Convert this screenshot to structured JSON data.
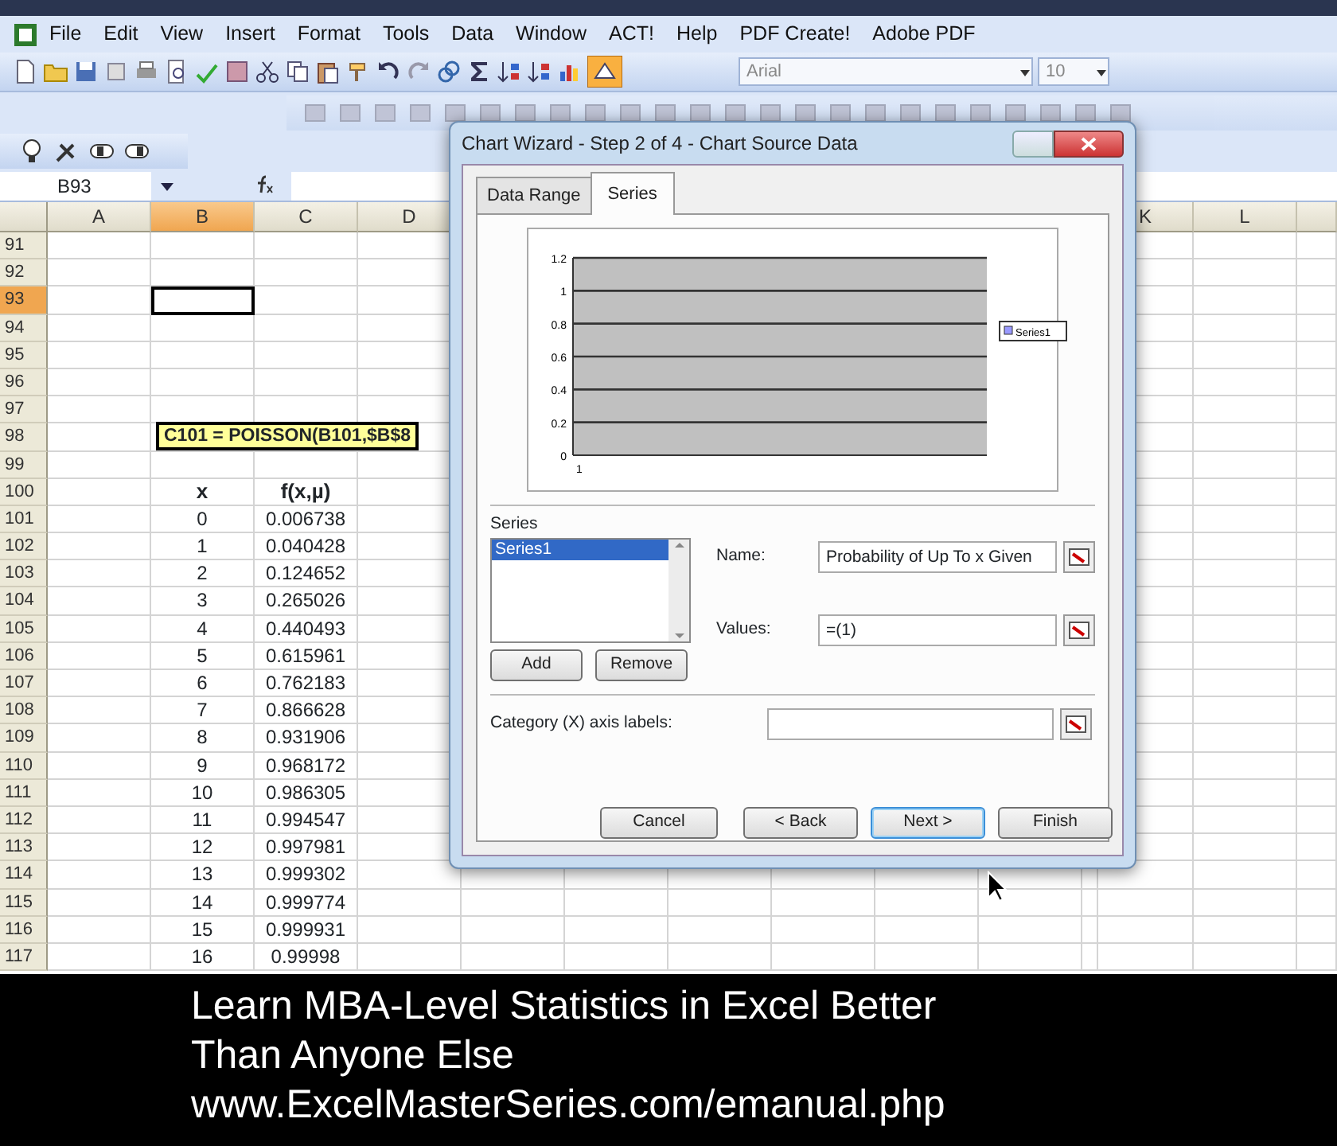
{
  "menu_bar": {
    "items": [
      "File",
      "Edit",
      "View",
      "Insert",
      "Format",
      "Tools",
      "Data",
      "Window",
      "ACT!",
      "Help",
      "PDF Create!",
      "Adobe PDF"
    ]
  },
  "formatting": {
    "font": "Arial",
    "font_size": "10"
  },
  "name_box": "B93",
  "sheet": {
    "columns": [
      {
        "label": "A",
        "selected": false
      },
      {
        "label": "B",
        "selected": true
      },
      {
        "label": "C",
        "selected": false
      },
      {
        "label": "D",
        "selected": false
      },
      {
        "label": "K",
        "selected": false
      },
      {
        "label": "L",
        "selected": false
      }
    ],
    "rows": [
      {
        "number": "91",
        "selected": false
      },
      {
        "number": "92",
        "selected": false
      },
      {
        "number": "93",
        "selected": true
      },
      {
        "number": "94",
        "selected": false
      },
      {
        "number": "95",
        "selected": false
      },
      {
        "number": "96",
        "selected": false
      },
      {
        "number": "97",
        "selected": false
      },
      {
        "number": "98",
        "selected": false,
        "note": "C101 = POISSON(B101,$B$8"
      },
      {
        "number": "99",
        "selected": false
      },
      {
        "number": "100",
        "selected": false,
        "kind": "header",
        "column_b": "x",
        "column_c": "f(x,µ)"
      },
      {
        "number": "101",
        "selected": false,
        "column_b": "0",
        "column_c": "0.006738"
      },
      {
        "number": "102",
        "selected": false,
        "column_b": "1",
        "column_c": "0.040428"
      },
      {
        "number": "103",
        "selected": false,
        "column_b": "2",
        "column_c": "0.124652"
      },
      {
        "number": "104",
        "selected": false,
        "column_b": "3",
        "column_c": "0.265026"
      },
      {
        "number": "105",
        "selected": false,
        "column_b": "4",
        "column_c": "0.440493"
      },
      {
        "number": "106",
        "selected": false,
        "column_b": "5",
        "column_c": "0.615961"
      },
      {
        "number": "107",
        "selected": false,
        "column_b": "6",
        "column_c": "0.762183"
      },
      {
        "number": "108",
        "selected": false,
        "column_b": "7",
        "column_c": "0.866628"
      },
      {
        "number": "109",
        "selected": false,
        "column_b": "8",
        "column_c": "0.931906"
      },
      {
        "number": "110",
        "selected": false,
        "column_b": "9",
        "column_c": "0.968172"
      },
      {
        "number": "111",
        "selected": false,
        "column_b": "10",
        "column_c": "0.986305"
      },
      {
        "number": "112",
        "selected": false,
        "column_b": "11",
        "column_c": "0.994547"
      },
      {
        "number": "113",
        "selected": false,
        "column_b": "12",
        "column_c": "0.997981"
      },
      {
        "number": "114",
        "selected": false,
        "column_b": "13",
        "column_c": "0.999302"
      },
      {
        "number": "115",
        "selected": false,
        "column_b": "14",
        "column_c": "0.999774"
      },
      {
        "number": "116",
        "selected": false,
        "column_b": "15",
        "column_c": "0.999931"
      },
      {
        "number": "117",
        "selected": false,
        "column_b": "16",
        "column_c": "0.99998"
      }
    ]
  },
  "dialog": {
    "title": "Chart Wizard - Step 2 of 4 - Chart Source Data",
    "tabs": [
      {
        "label": "Data Range",
        "selected": false
      },
      {
        "label": "Series",
        "selected": true
      }
    ],
    "chart_preview": {
      "chart_data": {
        "type": "bar",
        "grid": true,
        "categories": [
          "1"
        ],
        "ylim": [
          0,
          1.2
        ],
        "yticks": [
          0,
          0.2,
          0.4,
          0.6,
          0.8,
          1,
          1.2
        ],
        "series": [
          {
            "name": "Series1",
            "color": "#9999ff",
            "values": [
              null
            ]
          }
        ]
      }
    },
    "series_label": "Series",
    "series_list": [
      {
        "label": "Series1",
        "selected": true
      }
    ],
    "list_buttons": [
      "Add",
      "Remove"
    ],
    "fields": [
      {
        "label": "Name:",
        "value": "Probability of Up To x Given"
      },
      {
        "label": "Values:",
        "value": "=(1)"
      }
    ],
    "category_field": {
      "label": "Category (X) axis labels:"
    },
    "buttons": [
      {
        "label": "Cancel",
        "default": false
      },
      {
        "label": "< Back",
        "default": false
      },
      {
        "label": "Next >",
        "default": true
      },
      {
        "label": "Finish",
        "default": false
      }
    ]
  },
  "caption": [
    "Learn MBA-Level Statistics in Excel Better",
    "Than Anyone Else",
    "www.ExcelMasterSeries.com/emanual.php"
  ]
}
